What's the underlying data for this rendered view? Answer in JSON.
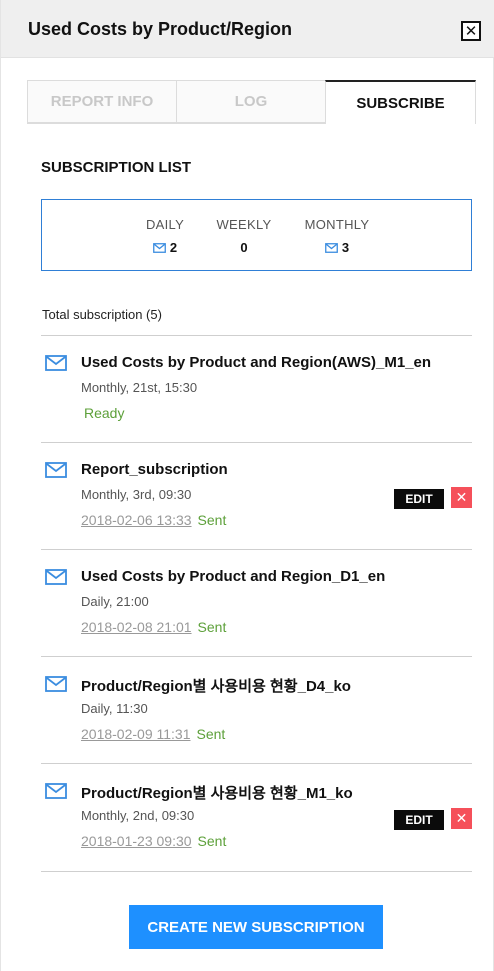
{
  "header": {
    "title": "Used Costs by Product/Region",
    "close_glyph": "✕"
  },
  "tabs": [
    {
      "label": "REPORT INFO",
      "active": false
    },
    {
      "label": "LOG",
      "active": false
    },
    {
      "label": "SUBSCRIBE",
      "active": true
    }
  ],
  "summary": {
    "title": "SUBSCRIPTION LIST",
    "daily": {
      "label": "DAILY",
      "count": "2",
      "icon": "mail-icon"
    },
    "weekly": {
      "label": "WEEKLY",
      "count": "0"
    },
    "monthly": {
      "label": "MONTHLY",
      "count": "3",
      "icon": "mail-icon"
    }
  },
  "total_label": "Total subscription (5)",
  "subscriptions": [
    {
      "name": "Used Costs by Product and Region(AWS)_M1_en",
      "schedule": "Monthly, 21st, 15:30",
      "status": "Ready",
      "last_sent": "",
      "has_actions": false
    },
    {
      "name": "Report_subscription",
      "schedule": "Monthly, 3rd, 09:30",
      "status": "Sent",
      "last_sent": "2018-02-06 13:33",
      "has_actions": true
    },
    {
      "name": "Used Costs by Product and Region_D1_en",
      "schedule": "Daily, 21:00",
      "status": "Sent",
      "last_sent": "2018-02-08 21:01",
      "has_actions": false
    },
    {
      "name": "Product/Region별 사용비용 현황_D4_ko",
      "schedule": "Daily, 11:30",
      "status": "Sent",
      "last_sent": "2018-02-09 11:31",
      "has_actions": false
    },
    {
      "name": "Product/Region별 사용비용 현황_M1_ko",
      "schedule": "Monthly, 2nd, 09:30",
      "status": "Sent",
      "last_sent": "2018-01-23 09:30",
      "has_actions": true
    }
  ],
  "actions": {
    "edit_label": "EDIT",
    "delete_glyph": "✕"
  },
  "create_button_label": "CREATE NEW SUBSCRIPTION",
  "colors": {
    "accent": "#1e90ff",
    "sent_green": "#5da03a",
    "delete_red": "#f5505a",
    "box_border": "#2f7fd6"
  }
}
